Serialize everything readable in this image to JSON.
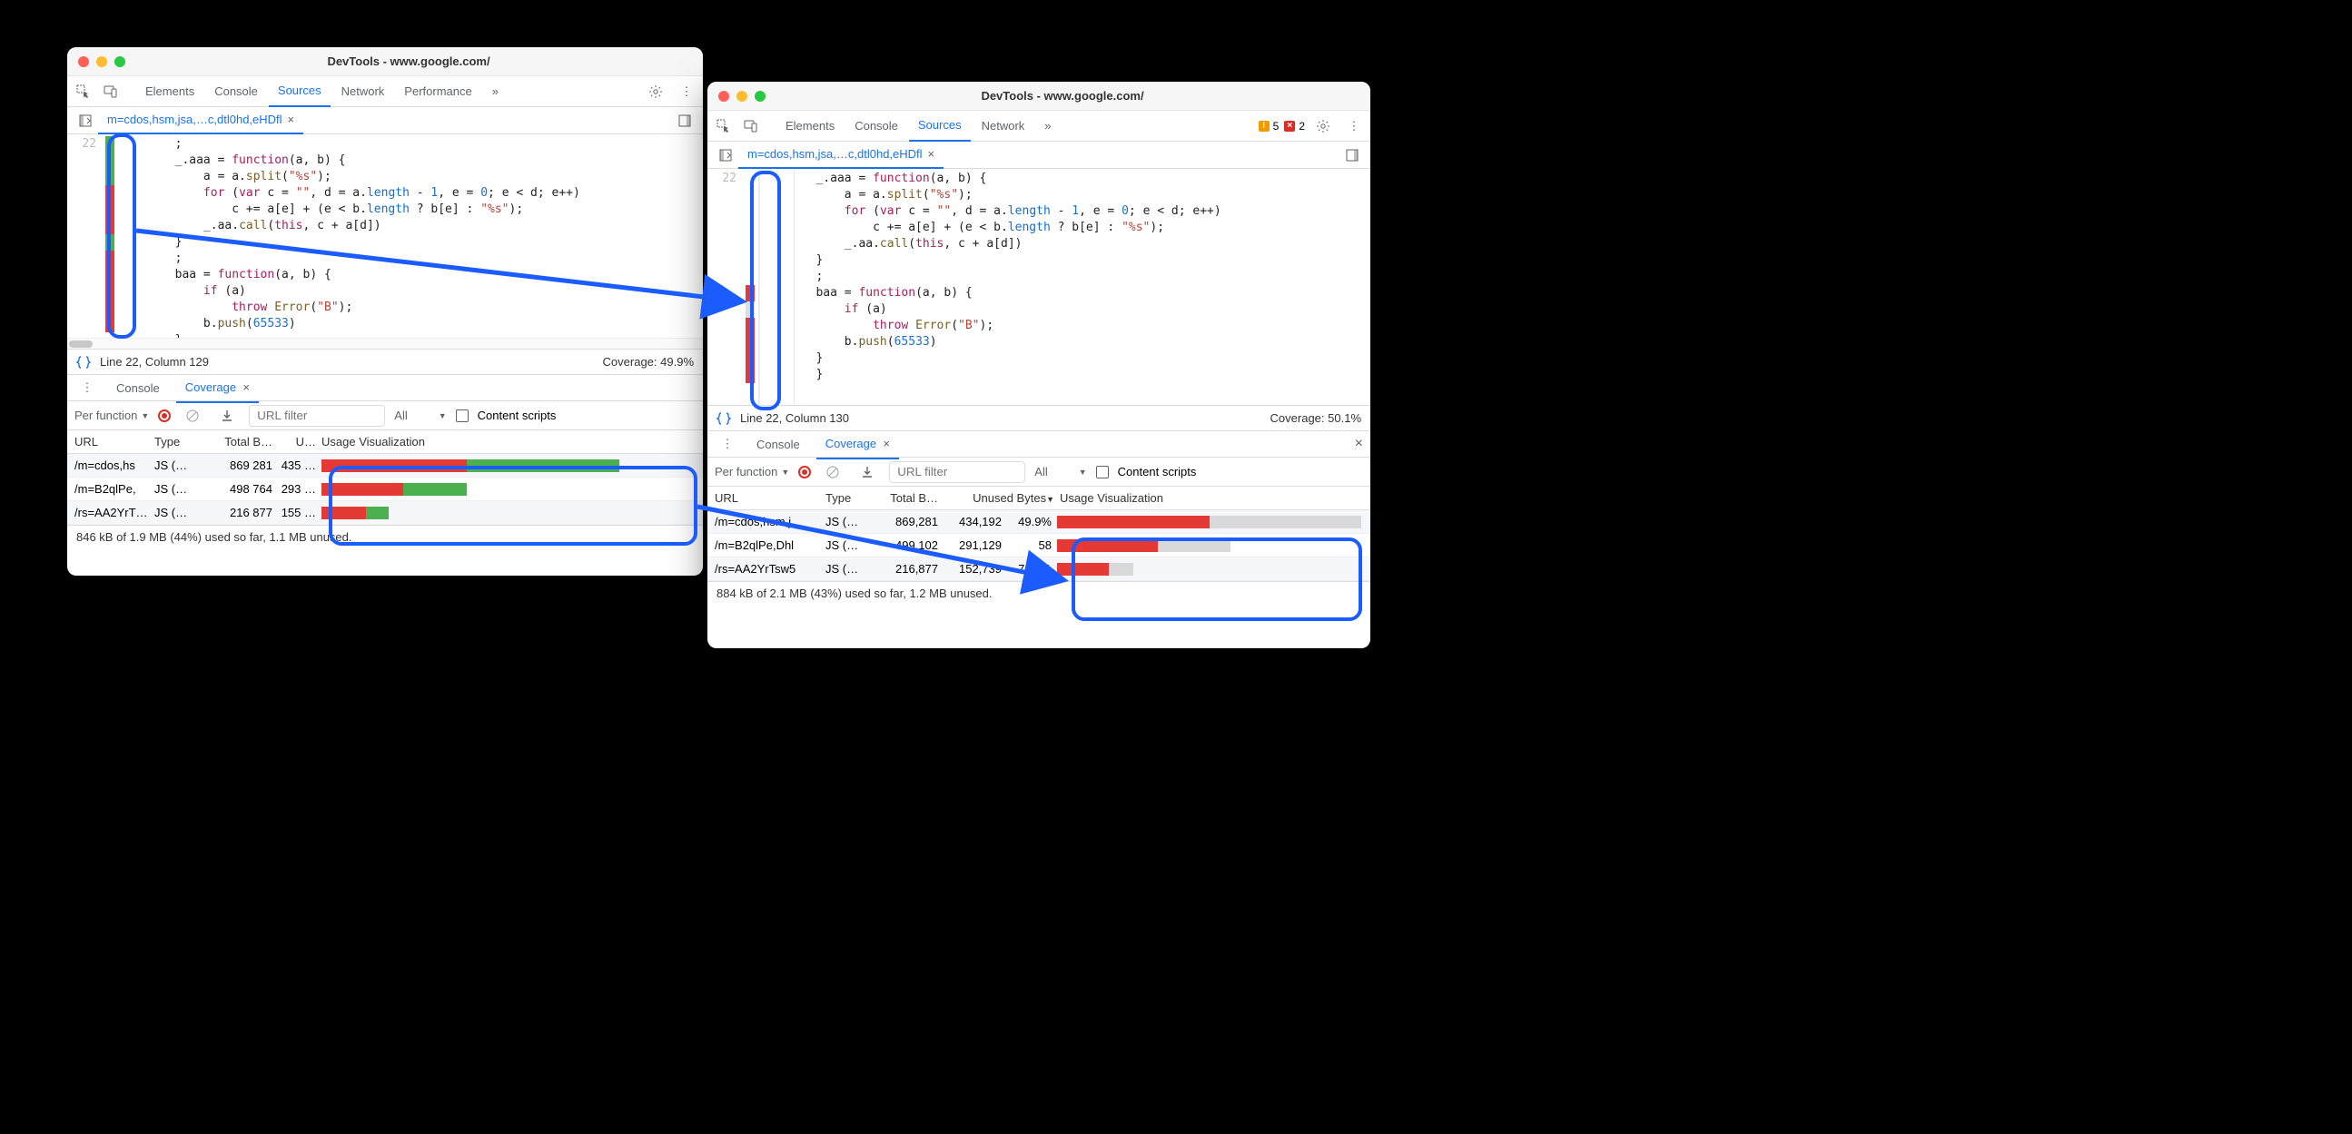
{
  "windowA": {
    "title": "DevTools - www.google.com/",
    "tabs": [
      "Elements",
      "Console",
      "Sources",
      "Network",
      "Performance"
    ],
    "active_tab": "Sources",
    "more_glyph": "»",
    "file_tab": "m=cdos,hsm,jsa,…c,dtl0hd,eHDfl",
    "line_no": "22",
    "code_lines": [
      "        ;",
      "        _.aaa = function(a, b) {",
      "            a = a.split(\"%s\");",
      "            for (var c = \"\", d = a.length - 1, e = 0; e < d; e++)",
      "                c += a[e] + (e < b.length ? b[e] : \"%s\");",
      "            _.aa.call(this, c + a[d])",
      "        }",
      "        ;",
      "        baa = function(a, b) {",
      "            if (a)",
      "                throw Error(\"B\");",
      "            b.push(65533)",
      "        }"
    ],
    "status_left": "Line 22, Column 129",
    "status_right": "Coverage: 49.9%",
    "drawer": {
      "console": "Console",
      "coverage": "Coverage"
    },
    "toolbar": {
      "per_func": "Per function",
      "url_filter_ph": "URL filter",
      "type_filter": "All",
      "content_scripts": "Content scripts"
    },
    "coverage_headers": {
      "url": "URL",
      "type": "Type",
      "total": "Total B…",
      "unused": "U…",
      "viz": "Usage Visualization"
    },
    "coverage_rows": [
      {
        "url": "/m=cdos,hs",
        "type": "JS (…",
        "total": "869 281",
        "unused": "435 …",
        "viz": {
          "redW": 39,
          "greenW": 41
        }
      },
      {
        "url": "/m=B2qlPe,",
        "type": "JS (…",
        "total": "498 764",
        "unused": "293 …",
        "viz": {
          "redW": 22,
          "greenW": 17
        }
      },
      {
        "url": "/rs=AA2YrT…",
        "type": "JS (…",
        "total": "216 877",
        "unused": "155 …",
        "viz": {
          "redW": 12,
          "greenW": 6
        }
      }
    ],
    "footer": "846 kB of 1.9 MB (44%) used so far, 1.1 MB unused."
  },
  "windowB": {
    "title": "DevTools - www.google.com/",
    "tabs": [
      "Elements",
      "Console",
      "Sources",
      "Network"
    ],
    "active_tab": "Sources",
    "more_glyph": "»",
    "warnings": "5",
    "errors": "2",
    "file_tab": "m=cdos,hsm,jsa,…c,dtl0hd,eHDfl",
    "line_no": "22",
    "code_lines": [
      "        _.aaa = function(a, b) {",
      "            a = a.split(\"%s\");",
      "            for (var c = \"\", d = a.length - 1, e = 0; e < d; e++)",
      "                c += a[e] + (e < b.length ? b[e] : \"%s\");",
      "            _.aa.call(this, c + a[d])",
      "        }",
      "        ;",
      "        baa = function(a, b) {",
      "            if (a)",
      "                throw Error(\"B\");",
      "            b.push(65533)",
      "        }",
      "        }"
    ],
    "status_left": "Line 22, Column 130",
    "status_right": "Coverage: 50.1%",
    "drawer": {
      "console": "Console",
      "coverage": "Coverage"
    },
    "toolbar": {
      "per_func": "Per function",
      "url_filter_ph": "URL filter",
      "type_filter": "All",
      "content_scripts": "Content scripts"
    },
    "coverage_headers": {
      "url": "URL",
      "type": "Type",
      "total": "Total B…",
      "unused": "Unused Bytes",
      "viz": "Usage Visualization"
    },
    "coverage_rows": [
      {
        "url": "/m=cdos,hsm,j",
        "type": "JS (…",
        "total": "869,281",
        "unused": "434,192",
        "pct": "49.9%",
        "viz": {
          "redW": 50,
          "fullW": 100
        }
      },
      {
        "url": "/m=B2qlPe,Dhl",
        "type": "JS (…",
        "total": "499,102",
        "unused": "291,129",
        "pct": "58",
        "viz": {
          "redW": 33,
          "fullW": 57
        }
      },
      {
        "url": "/rs=AA2YrTsw5",
        "type": "JS (…",
        "total": "216,877",
        "unused": "152,739",
        "pct": "70.4%",
        "viz": {
          "redW": 17,
          "fullW": 25
        }
      }
    ],
    "footer": "884 kB of 2.1 MB (43%) used so far, 1.2 MB unused."
  }
}
